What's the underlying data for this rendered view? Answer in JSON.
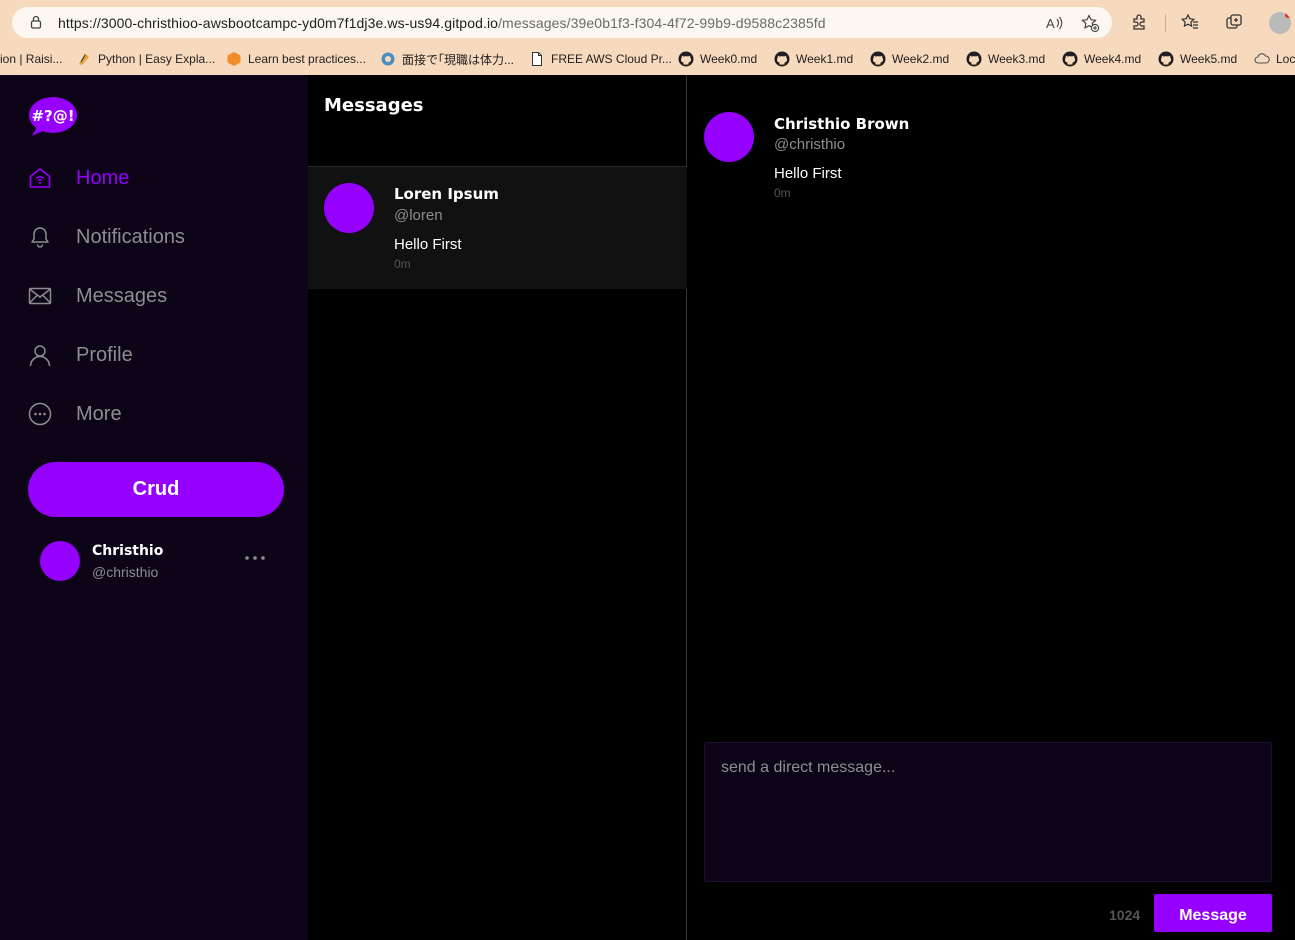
{
  "browser": {
    "url_host": "https://3000-christhioo-awsbootcampc-yd0m7f1dj3e.ws-us94.gitpod.io",
    "url_path": "/messages/39e0b1f3-f304-4f72-99b9-d9588c2385fd",
    "bookmarks": [
      {
        "label": "ion | Raisi...",
        "icon": "page-icon"
      },
      {
        "label": "Python | Easy Expla...",
        "icon": "python-icon"
      },
      {
        "label": "Learn best practices...",
        "icon": "aws-icon"
      },
      {
        "label": "面接で｢現職は体力...",
        "icon": "globe-icon"
      },
      {
        "label": "FREE AWS Cloud Pr...",
        "icon": "page-icon"
      },
      {
        "label": "Week0.md",
        "icon": "github-icon"
      },
      {
        "label": "Week1.md",
        "icon": "github-icon"
      },
      {
        "label": "Week2.md",
        "icon": "github-icon"
      },
      {
        "label": "Week3.md",
        "icon": "github-icon"
      },
      {
        "label": "Week4.md",
        "icon": "github-icon"
      },
      {
        "label": "Week5.md",
        "icon": "github-icon"
      },
      {
        "label": "Loc",
        "icon": "cloud-icon"
      }
    ]
  },
  "sidebar": {
    "logo_text": "#?@!",
    "items": [
      {
        "label": "Home",
        "icon": "home-icon",
        "active": true
      },
      {
        "label": "Notifications",
        "icon": "bell-icon",
        "active": false
      },
      {
        "label": "Messages",
        "icon": "mail-icon",
        "active": false
      },
      {
        "label": "Profile",
        "icon": "user-icon",
        "active": false
      },
      {
        "label": "More",
        "icon": "more-circle-icon",
        "active": false
      }
    ],
    "crud_label": "Crud",
    "user": {
      "display_name": "Christhio",
      "handle": "@christhio"
    }
  },
  "groups": {
    "title": "Messages",
    "items": [
      {
        "name": "Loren Ipsum",
        "handle": "@loren",
        "message": "Hello First",
        "time": "0m"
      }
    ]
  },
  "conversation": {
    "messages": [
      {
        "name": "Christhio Brown",
        "handle": "@christhio",
        "message": "Hello First",
        "time": "0m"
      }
    ],
    "input_placeholder": "send a direct message...",
    "char_count": "1024",
    "send_label": "Message"
  },
  "colors": {
    "accent": "#9500ff",
    "sidebar_bg": "#0d0417",
    "browser_chrome": "#f7d9bd"
  }
}
